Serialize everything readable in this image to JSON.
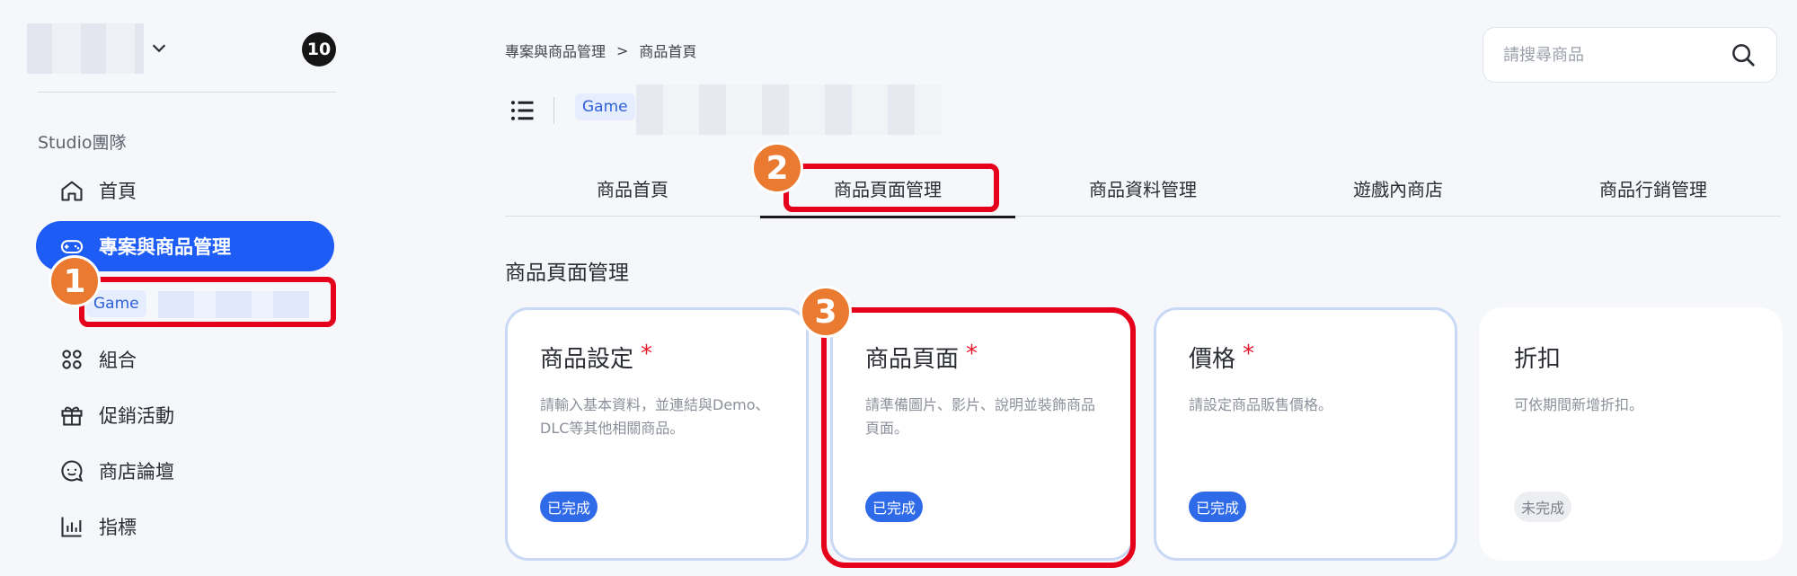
{
  "sidebar": {
    "notification_count": "10",
    "team_label": "Studio團隊",
    "items": [
      {
        "label": "首頁",
        "icon": "home-icon"
      },
      {
        "label": "專案與商品管理",
        "icon": "gamepad-icon",
        "active": true
      },
      {
        "label": "組合",
        "icon": "bundle-icon"
      },
      {
        "label": "促銷活動",
        "icon": "gift-icon"
      },
      {
        "label": "商店論壇",
        "icon": "chat-icon"
      },
      {
        "label": "指標",
        "icon": "chart-icon"
      }
    ],
    "sub_item": {
      "tag": "Game"
    }
  },
  "header": {
    "breadcrumb": [
      "專案與商品管理",
      "商品首頁"
    ],
    "breadcrumb_separator": ">",
    "title_tag": "Game",
    "search_placeholder": "請搜尋商品"
  },
  "tabs": [
    {
      "label": "商品首頁"
    },
    {
      "label": "商品頁面管理",
      "active": true
    },
    {
      "label": "商品資料管理"
    },
    {
      "label": "遊戲內商店"
    },
    {
      "label": "商品行銷管理"
    }
  ],
  "section_title": "商品頁面管理",
  "cards": [
    {
      "title": "商品設定",
      "required": "*",
      "desc": "請輸入基本資料，並連結與Demo、DLC等其他相關商品。",
      "status": "已完成",
      "done": true
    },
    {
      "title": "商品頁面",
      "required": "*",
      "desc": "請準備圖片、影片、說明並裝飾商品頁面。",
      "status": "已完成",
      "done": true
    },
    {
      "title": "價格",
      "required": "*",
      "desc": "請設定商品販售價格。",
      "status": "已完成",
      "done": true
    },
    {
      "title": "折扣",
      "required": "",
      "desc": "可依期間新增折扣。",
      "status": "未完成",
      "done": false
    }
  ],
  "annotations": {
    "markers": [
      "1",
      "2",
      "3"
    ],
    "color": "#e5001b",
    "marker_color": "#ea7a2f"
  },
  "colors": {
    "primary": "#1d5cf5",
    "done_badge": "#2f6ae8",
    "required": "#e8182b"
  }
}
